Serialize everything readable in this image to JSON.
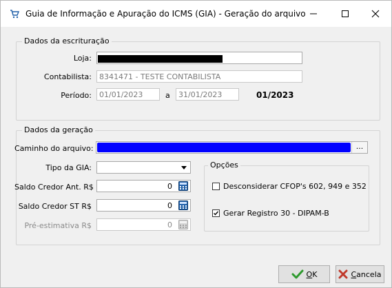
{
  "window": {
    "title": "Guia de Informação e Apuração do ICMS (GIA) - Geração do arquivo"
  },
  "escrituracao": {
    "legend": "Dados da escrituração",
    "loja_label": "Loja:",
    "contabilista_label": "Contabilista:",
    "contabilista_value": "8341471 - TESTE CONTABILISTA",
    "periodo_label": "Período:",
    "periodo_inicio": "01/01/2023",
    "periodo_sep": "a",
    "periodo_fim": "31/01/2023",
    "periodo_ref": "01/2023"
  },
  "geracao": {
    "legend": "Dados da geração",
    "caminho_label": "Caminho do arquivo:",
    "browse_label": "...",
    "tipo_label": "Tipo da GIA:",
    "saldo_credor_ant_label": "Saldo Credor Ant. R$",
    "saldo_credor_ant_value": "0",
    "saldo_credor_st_label": "Saldo Credor ST  R$",
    "saldo_credor_st_value": "0",
    "pre_estimativa_label": "Pré-estimativa  R$",
    "pre_estimativa_value": "0"
  },
  "opcoes": {
    "legend": "Opções",
    "desconsiderar_label": "Desconsiderar CFOP's 602, 949 e 352",
    "desconsiderar_checked": false,
    "gerar_label": "Gerar Registro 30 - DIPAM-B",
    "gerar_checked": true
  },
  "buttons": {
    "ok_accel": "O",
    "ok_rest": "K",
    "cancel_accel": "C",
    "cancel_rest": "ancela"
  },
  "colors": {
    "path_fill": "#0000ff",
    "ok_icon": "#2e9a2e",
    "cancel_icon": "#c0392b",
    "calc_icon": "#1f5fa8"
  },
  "icons": {
    "app": "cart-icon",
    "minimize": "minimize-icon",
    "maximize": "maximize-icon",
    "close": "close-icon",
    "calc": "calculator-icon",
    "ok": "checkmark-icon",
    "cancel": "x-icon"
  }
}
